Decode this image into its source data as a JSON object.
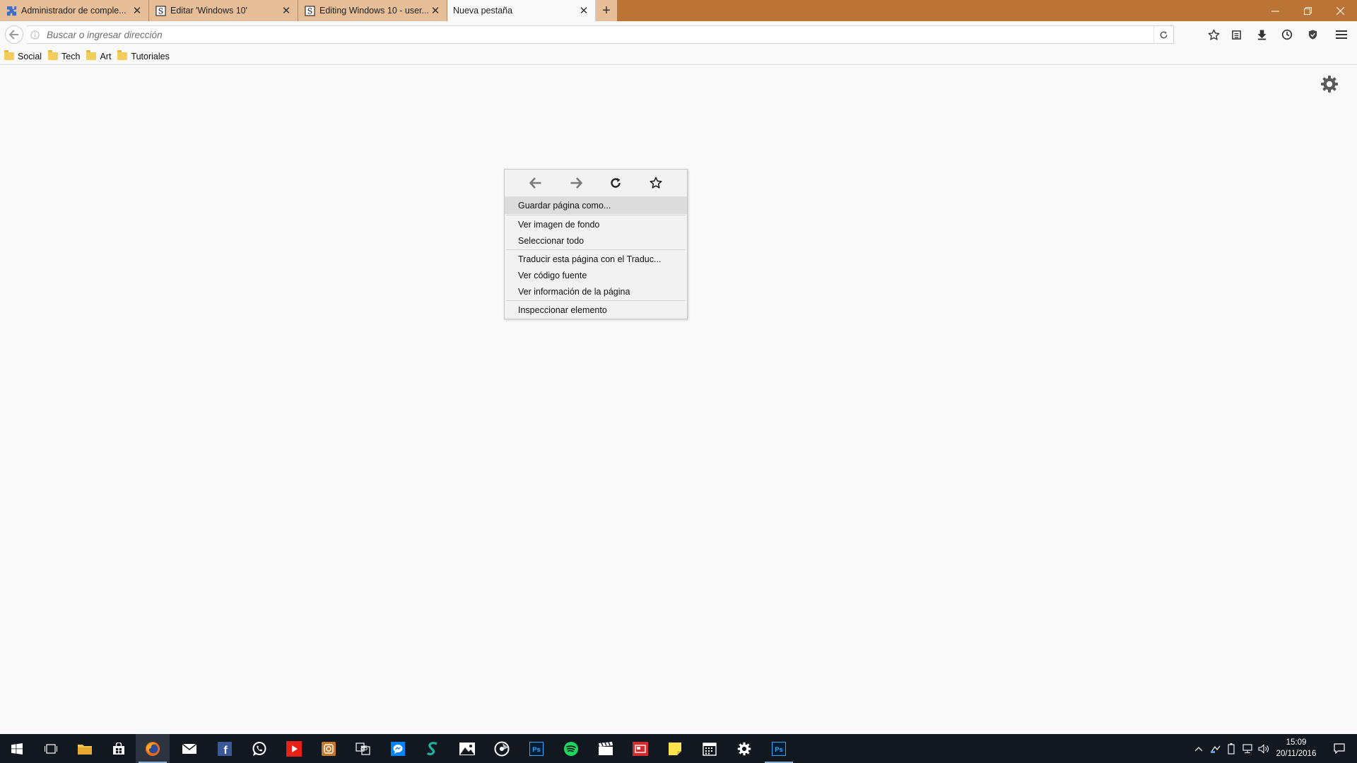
{
  "tabs": [
    {
      "title": "Administrador de comple..."
    },
    {
      "title": "Editar 'Windows 10'"
    },
    {
      "title": "Editing Windows 10 - user..."
    },
    {
      "title": "Nueva pestaña"
    }
  ],
  "urlbar": {
    "placeholder": "Buscar o ingresar dirección",
    "value": ""
  },
  "bookmarks": [
    {
      "label": "Social"
    },
    {
      "label": "Tech"
    },
    {
      "label": "Art"
    },
    {
      "label": "Tutoriales"
    }
  ],
  "context_menu": {
    "items": [
      {
        "label": "Guardar página como..."
      },
      {
        "label": "Ver imagen de fondo"
      },
      {
        "label": "Seleccionar todo"
      },
      {
        "label": "Traducir esta página con el Traduc..."
      },
      {
        "label": "Ver código fuente"
      },
      {
        "label": "Ver información de la página"
      },
      {
        "label": "Inspeccionar elemento"
      }
    ]
  },
  "clock": {
    "time": "15:09",
    "date": "20/11/2016"
  },
  "colors": {
    "tabstrip": "#b97436",
    "inactive_tab": "#e6be98",
    "taskbar": "#111820"
  }
}
